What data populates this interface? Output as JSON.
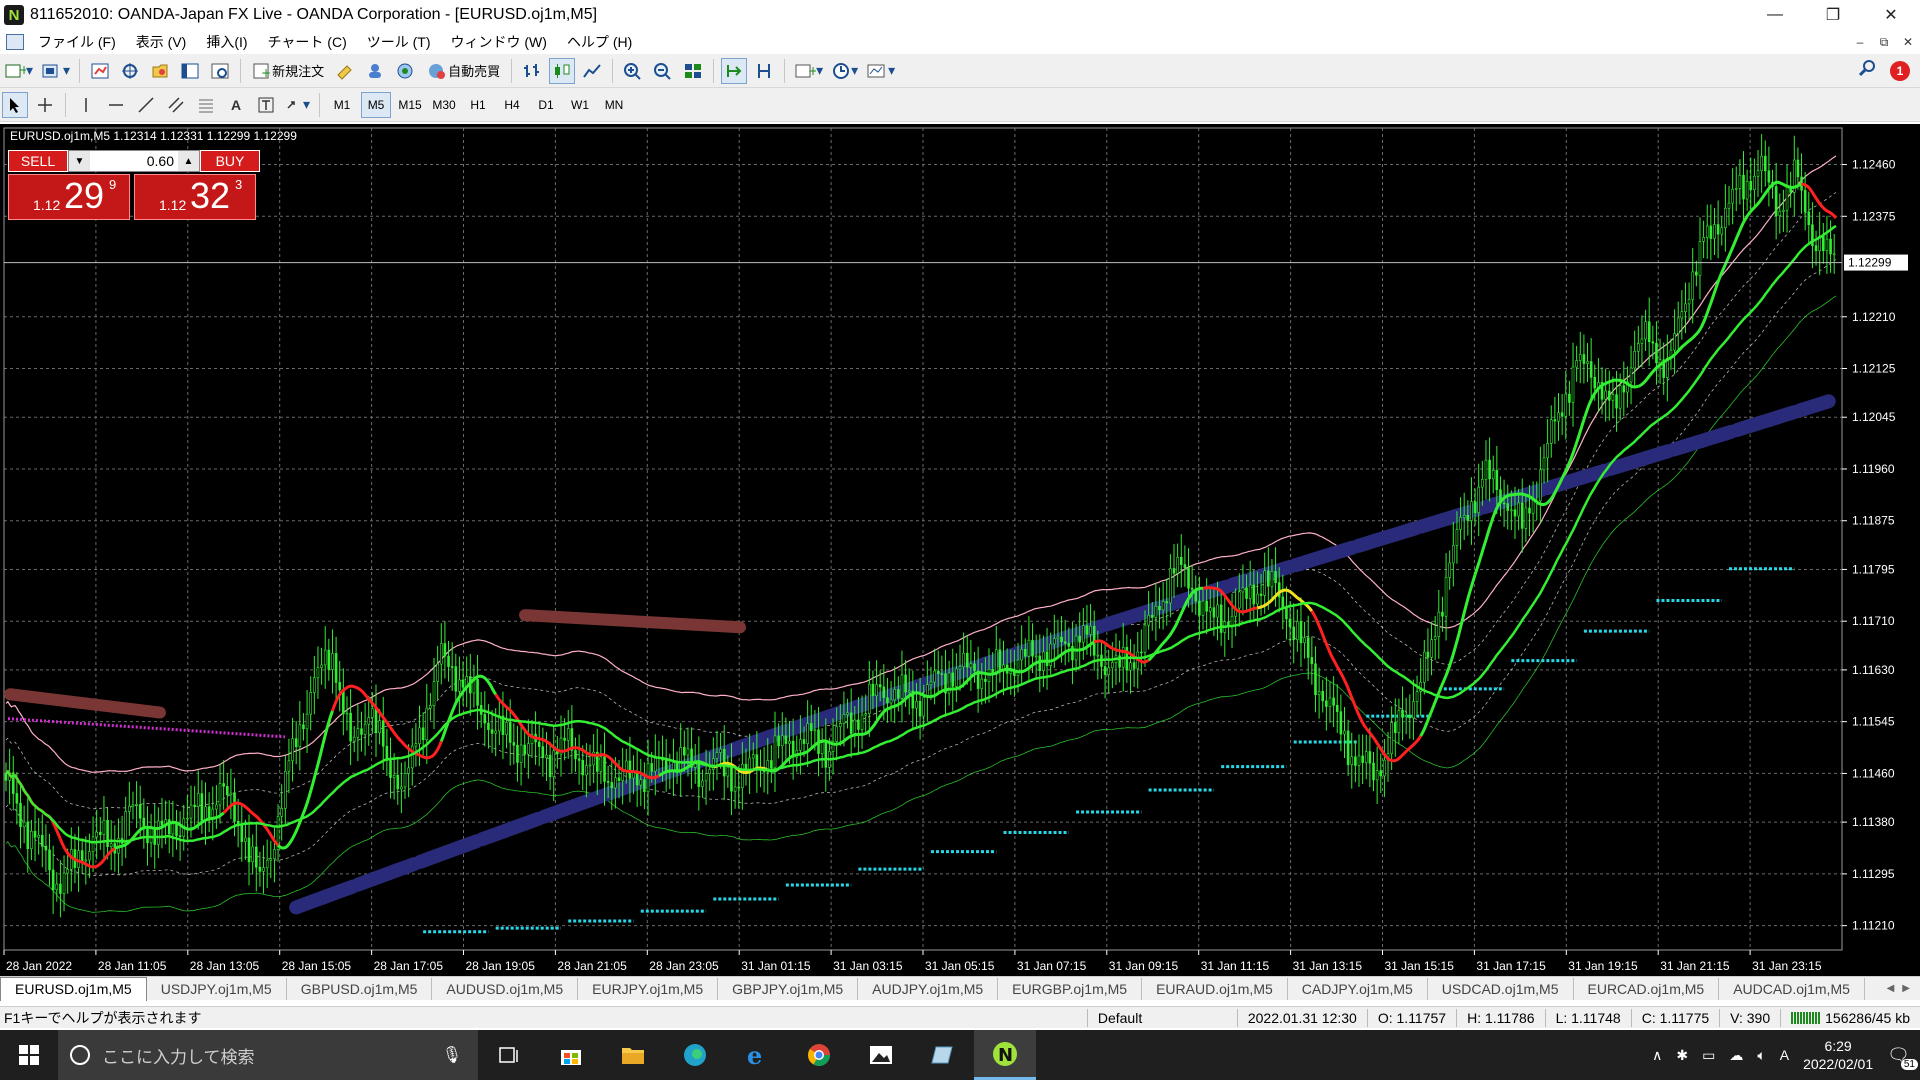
{
  "window": {
    "title": "811652010: OANDA-Japan FX Live - OANDA Corporation - [EURUSD.oj1m,M5]",
    "logo": "N",
    "minimize": "—",
    "restore": "❐",
    "close": "✕"
  },
  "menu": [
    "ファイル (F)",
    "表示 (V)",
    "挿入(I)",
    "チャート (C)",
    "ツール (T)",
    "ウィンドウ (W)",
    "ヘルプ (H)"
  ],
  "mdi": [
    "–",
    "⧉",
    "✕"
  ],
  "toolbar": {
    "new_order": "新規注文",
    "auto_trade": "自動売買",
    "notification_count": "1"
  },
  "timeframes": [
    "M1",
    "M5",
    "M15",
    "M30",
    "H1",
    "H4",
    "D1",
    "W1",
    "MN"
  ],
  "active_timeframe": "M5",
  "trade_panel": {
    "sell_label": "SELL",
    "buy_label": "BUY",
    "volume": "0.60",
    "sell_prefix": "1.12",
    "sell_big": "29",
    "sell_sup": "9",
    "buy_prefix": "1.12",
    "buy_big": "32",
    "buy_sup": "3"
  },
  "chart_data": {
    "type": "candlestick",
    "header": "EURUSD.oj1m,M5  1.12314 1.12331 1.12299 1.12299",
    "symbol": "EURUSD.oj1m",
    "timeframe": "M5",
    "ohlc": {
      "open": 1.12314,
      "high": 1.12331,
      "low": 1.12299,
      "close": 1.12299
    },
    "current_price": "1.12299",
    "y_ticks": [
      "1.12460",
      "1.12375",
      "1.12210",
      "1.12125",
      "1.12045",
      "1.11960",
      "1.11875",
      "1.11795",
      "1.11710",
      "1.11630",
      "1.11545",
      "1.11460",
      "1.11380",
      "1.11295",
      "1.11210"
    ],
    "ylim": [
      1.1117,
      1.1252
    ],
    "x_ticks": [
      "28 Jan 2022",
      "28 Jan 11:05",
      "28 Jan 13:05",
      "28 Jan 15:05",
      "28 Jan 17:05",
      "28 Jan 19:05",
      "28 Jan 21:05",
      "28 Jan 23:05",
      "31 Jan 01:15",
      "31 Jan 03:15",
      "31 Jan 05:15",
      "31 Jan 07:15",
      "31 Jan 09:15",
      "31 Jan 11:15",
      "31 Jan 13:15",
      "31 Jan 15:15",
      "31 Jan 17:15",
      "31 Jan 19:15",
      "31 Jan 21:15",
      "31 Jan 23:15"
    ],
    "price_path": [
      1.1146,
      1.1139,
      1.1134,
      1.1128,
      1.1131,
      1.1136,
      1.1134,
      1.114,
      1.1137,
      1.1136,
      1.1139,
      1.114,
      1.1143,
      1.1138,
      1.1128,
      1.1137,
      1.1152,
      1.116,
      1.1167,
      1.115,
      1.1157,
      1.1148,
      1.1144,
      1.1155,
      1.1165,
      1.1162,
      1.1157,
      1.1153,
      1.1151,
      1.115,
      1.1149,
      1.1151,
      1.1147,
      1.1146,
      1.1145,
      1.1146,
      1.1147,
      1.1149,
      1.1146,
      1.1148,
      1.1145,
      1.1147,
      1.1149,
      1.1151,
      1.1152,
      1.115,
      1.1154,
      1.1156,
      1.116,
      1.1159,
      1.1158,
      1.1161,
      1.1163,
      1.1163,
      1.1162,
      1.1164,
      1.1165,
      1.1166,
      1.1167,
      1.1169,
      1.1165,
      1.1163,
      1.1166,
      1.1172,
      1.118,
      1.1177,
      1.1171,
      1.1172,
      1.1175,
      1.1178,
      1.1174,
      1.1167,
      1.116,
      1.1154,
      1.1148,
      1.1146,
      1.1152,
      1.1158,
      1.1165,
      1.118,
      1.1189,
      1.1195,
      1.1192,
      1.1186,
      1.1195,
      1.1205,
      1.1213,
      1.1212,
      1.1205,
      1.1214,
      1.1218,
      1.1212,
      1.1225,
      1.1233,
      1.1238,
      1.1242,
      1.1246,
      1.1239,
      1.1244,
      1.1234,
      1.123
    ],
    "indicators": {
      "moving_average_colors": [
        "#ff2020",
        "#f0e020",
        "#33ee33"
      ],
      "envelope_outer_color": "#ffb0c8",
      "envelope_inner_color": "#ffffff",
      "long_ma_color": "#2a2a7a",
      "step_line_color": "#28d8e8",
      "resistance_color": "#7a3535",
      "pivot_color": "#d030d0"
    },
    "grid": true,
    "background": "#000000",
    "candle_color": "#33ee33"
  },
  "symbol_tabs": [
    "EURUSD.oj1m,M5",
    "USDJPY.oj1m,M5",
    "GBPUSD.oj1m,M5",
    "AUDUSD.oj1m,M5",
    "EURJPY.oj1m,M5",
    "GBPJPY.oj1m,M5",
    "AUDJPY.oj1m,M5",
    "EURGBP.oj1m,M5",
    "EURAUD.oj1m,M5",
    "CADJPY.oj1m,M5",
    "USDCAD.oj1m,M5",
    "EURCAD.oj1m,M5",
    "AUDCAD.oj1m,M5"
  ],
  "status": {
    "help": "F1キーでヘルプが表示されます",
    "profile": "Default",
    "datetime": "2022.01.31 12:30",
    "open": "O: 1.11757",
    "high": "H: 1.11786",
    "low": "L: 1.11748",
    "close": "C: 1.11775",
    "volume": "V: 390",
    "traffic": "156286/45 kb"
  },
  "taskbar": {
    "search_placeholder": "ここに入力して検索",
    "time": "6:29",
    "date": "2022/02/01",
    "ime": "A",
    "notifications": "51"
  }
}
